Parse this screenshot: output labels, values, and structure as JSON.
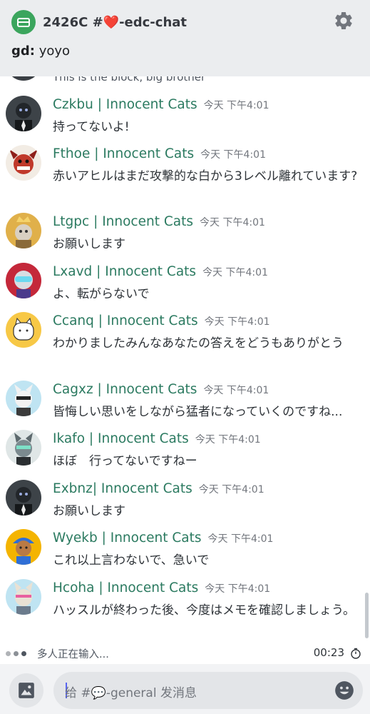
{
  "header": {
    "channel_name": "2426C #❤️-edc-chat",
    "topic_author": "gd:",
    "topic_text": " yoyo"
  },
  "partial_message": "This is the block, big brother",
  "messages": [
    {
      "author": "Czkbu | Innocent Cats",
      "time": "今天 下午4:01",
      "text": "持ってないよ!"
    },
    {
      "author": "Fthoe | Innocent Cats",
      "time": "今天 下午4:01",
      "text": "赤いアヒルはまだ攻撃的な白から3レベル離れています?"
    },
    {
      "author": "Ltgpc | Innocent Cats",
      "time": "今天 下午4:01",
      "text": "お願いします"
    },
    {
      "author": "Lxavd | Innocent Cats",
      "time": "今天 下午4:01",
      "text": "よ、転がらないで"
    },
    {
      "author": "Ccanq | Innocent Cats",
      "time": "今天 下午4:01",
      "text": "わかりましたみんなあなたの答えをどうもありがとう"
    },
    {
      "author": "Cagxz | Innocent Cats",
      "time": "今天 下午4:01",
      "text": "皆悔しい思いをしながら猛者になっていくのですね..."
    },
    {
      "author": "Ikafo | Innocent Cats",
      "time": "今天 下午4:01",
      "text": "ほぼ　行ってないですねー"
    },
    {
      "author": "Exbnz| Innocent Cats",
      "time": "今天 下午4:01",
      "text": "お願いします"
    },
    {
      "author": "Wyekb | Innocent Cats",
      "time": "今天 下午4:01",
      "text": "これ以上言わないで、急いで"
    },
    {
      "author": "Hcoha | Innocent Cats",
      "time": "今天 下午4:01",
      "text": "ハッスルが終わった後、今度はメモを確認しましょう。"
    }
  ],
  "typing": {
    "text": "多人正在输入...",
    "timer": "00:23"
  },
  "composer": {
    "placeholder": "给 #💬-general 发消息"
  },
  "colors": {
    "author": "#2b7a60",
    "header_bg": "#ebedef",
    "server_icon": "#3ba55d"
  },
  "icons": {
    "server": "server-icon",
    "settings": "gear-icon",
    "image": "image-icon",
    "emoji": "emoji-icon",
    "stopwatch": "stopwatch-icon"
  }
}
